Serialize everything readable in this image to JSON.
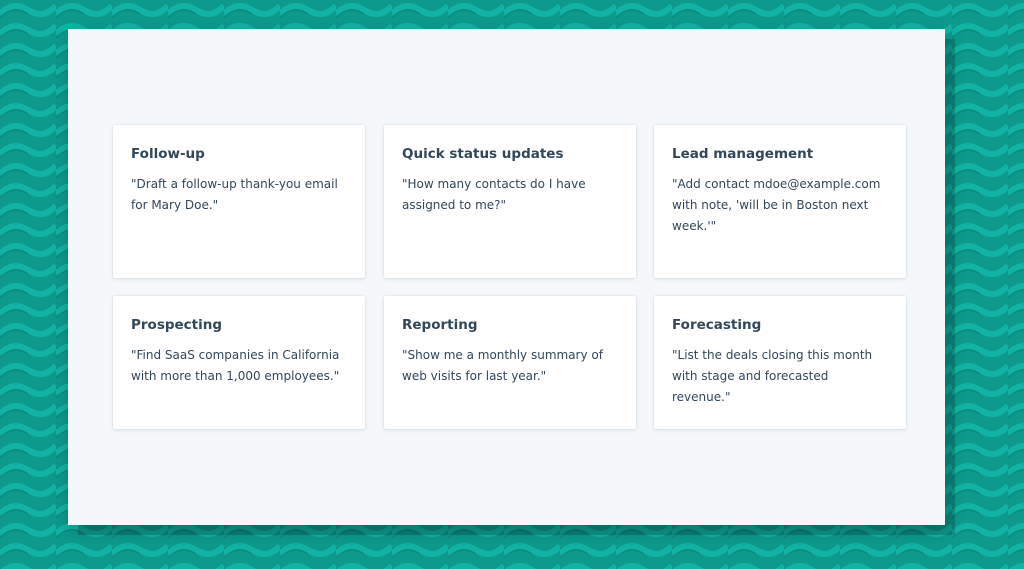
{
  "colors": {
    "background": "#0d9a8d",
    "panel": "#f5f8fa",
    "card": "#ffffff",
    "text": "#33475b"
  },
  "cards": [
    {
      "title": "Follow-up",
      "text": "\"Draft a follow-up thank-you email for Mary Doe.\""
    },
    {
      "title": "Quick status updates",
      "text": "\"How many contacts do I have assigned to me?\""
    },
    {
      "title": "Lead management",
      "text": "\"Add contact mdoe@example.com with note, 'will be in Boston next week.'\""
    },
    {
      "title": "Prospecting",
      "text": "\"Find SaaS companies in California with more than 1,000 employees.\""
    },
    {
      "title": "Reporting",
      "text": "\"Show me a monthly summary of web visits for last year.\""
    },
    {
      "title": "Forecasting",
      "text": "\"List the deals closing this month with stage and forecasted revenue.\""
    }
  ]
}
